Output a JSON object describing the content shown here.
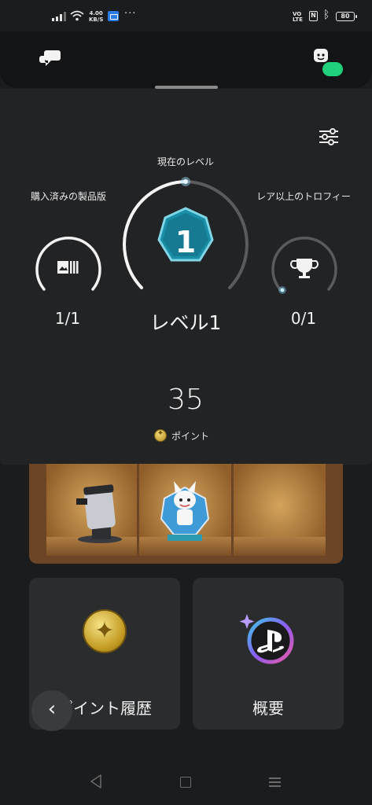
{
  "status_bar": {
    "network_speed_value": "4.00",
    "network_speed_unit": "KB/S",
    "overflow": "···",
    "volte_line1": "VO",
    "volte_line2": "LTE",
    "nfc": "N",
    "battery": "80"
  },
  "header": {
    "chat_icon": "speech-bubbles-icon",
    "avatar_icon": "avatar-icon",
    "online_color": "#21d07a"
  },
  "level_panel": {
    "current_level_label": "現在のレベル",
    "current_level_number": "1",
    "current_level_text": "レベル1",
    "purchased_label": "購入済みの製品版",
    "purchased_value": "1/1",
    "trophies_label": "レア以上のトロフィー",
    "trophies_value": "0/1",
    "points_value": "35",
    "points_label": "ポイント",
    "accent_color": "#1a8fa8"
  },
  "cards": {
    "points_history_label": "ポイント履歴",
    "overview_label": "概要"
  },
  "back_button": {
    "glyph": "‹"
  }
}
